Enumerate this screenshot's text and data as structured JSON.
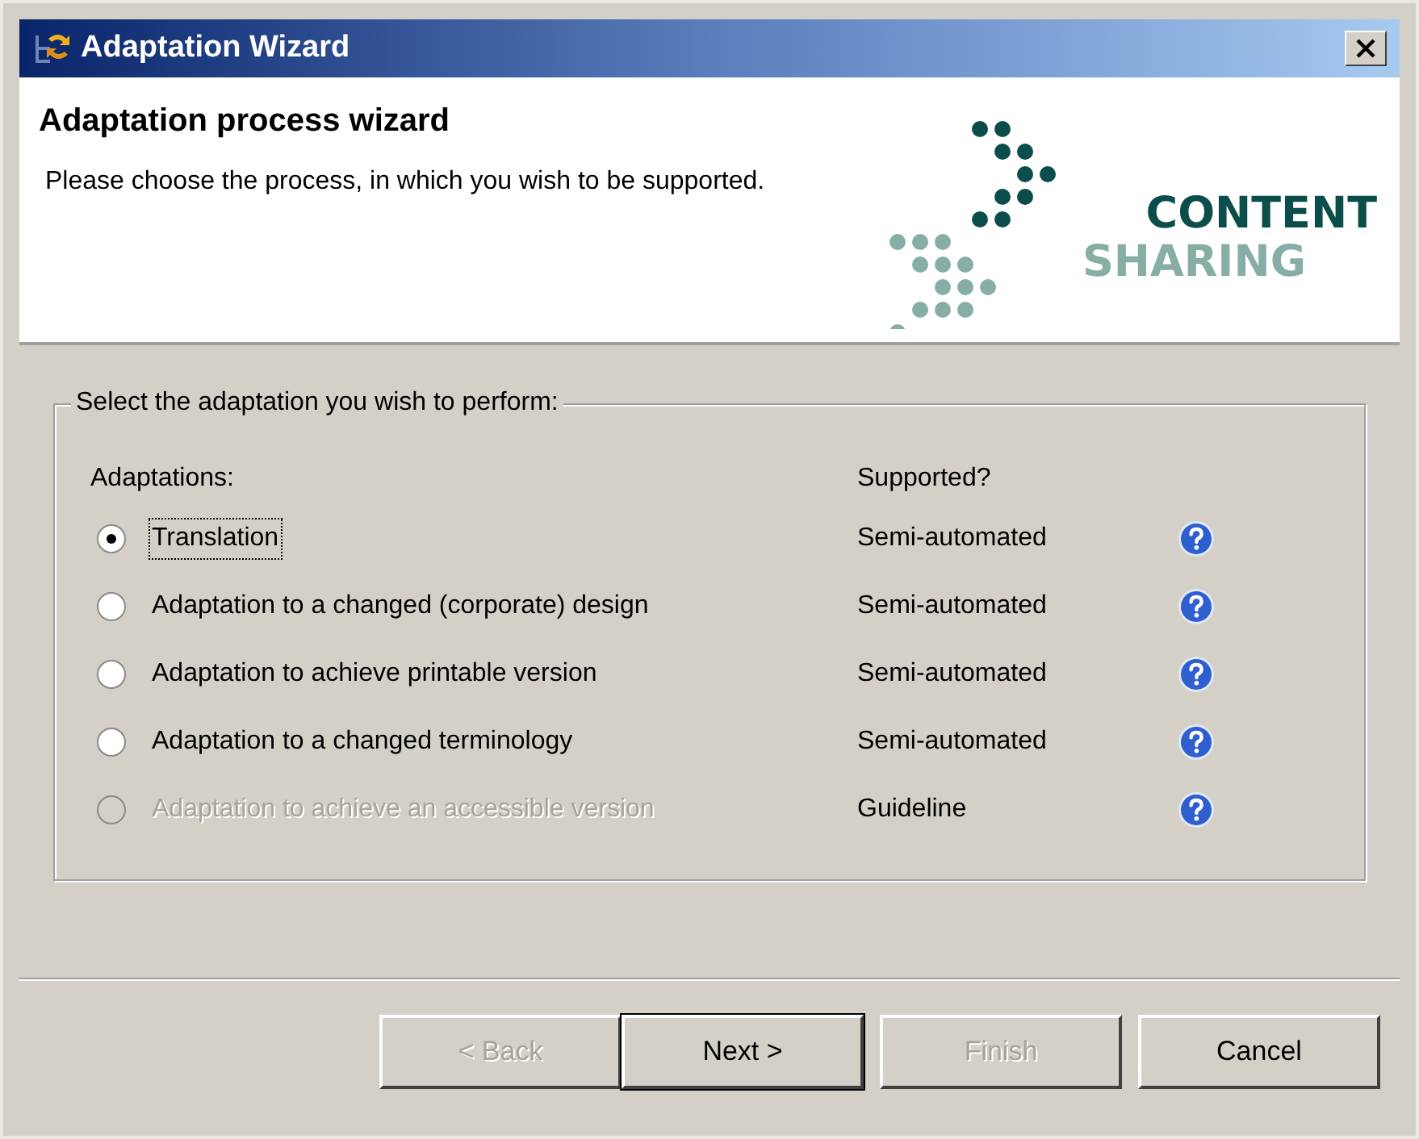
{
  "window": {
    "title": "Adaptation Wizard"
  },
  "header": {
    "title": "Adaptation process wizard",
    "description": "Please choose the process, in which you wish to be supported.",
    "logo": [
      "CONTENT",
      "SHARING"
    ]
  },
  "group": {
    "legend": "Select the adaptation you wish to perform:",
    "columns": [
      "Adaptations:",
      "Supported?"
    ],
    "rows": [
      {
        "label": "Translation",
        "support": "Semi-automated",
        "selected": true,
        "disabled": false,
        "focused": true
      },
      {
        "label": "Adaptation to a changed (corporate) design",
        "support": "Semi-automated",
        "selected": false,
        "disabled": false,
        "focused": false
      },
      {
        "label": "Adaptation to achieve printable version",
        "support": "Semi-automated",
        "selected": false,
        "disabled": false,
        "focused": false
      },
      {
        "label": "Adaptation to a changed terminology",
        "support": "Semi-automated",
        "selected": false,
        "disabled": false,
        "focused": false
      },
      {
        "label": "Adaptation to achieve an accessible version",
        "support": "Guideline",
        "selected": false,
        "disabled": true,
        "focused": false
      }
    ]
  },
  "buttons": [
    {
      "label": "< Back",
      "disabled": true,
      "default": false
    },
    {
      "label": "Next >",
      "disabled": false,
      "default": true
    },
    {
      "label": "Finish",
      "disabled": true,
      "default": false
    },
    {
      "label": "Cancel",
      "disabled": false,
      "default": false
    }
  ]
}
